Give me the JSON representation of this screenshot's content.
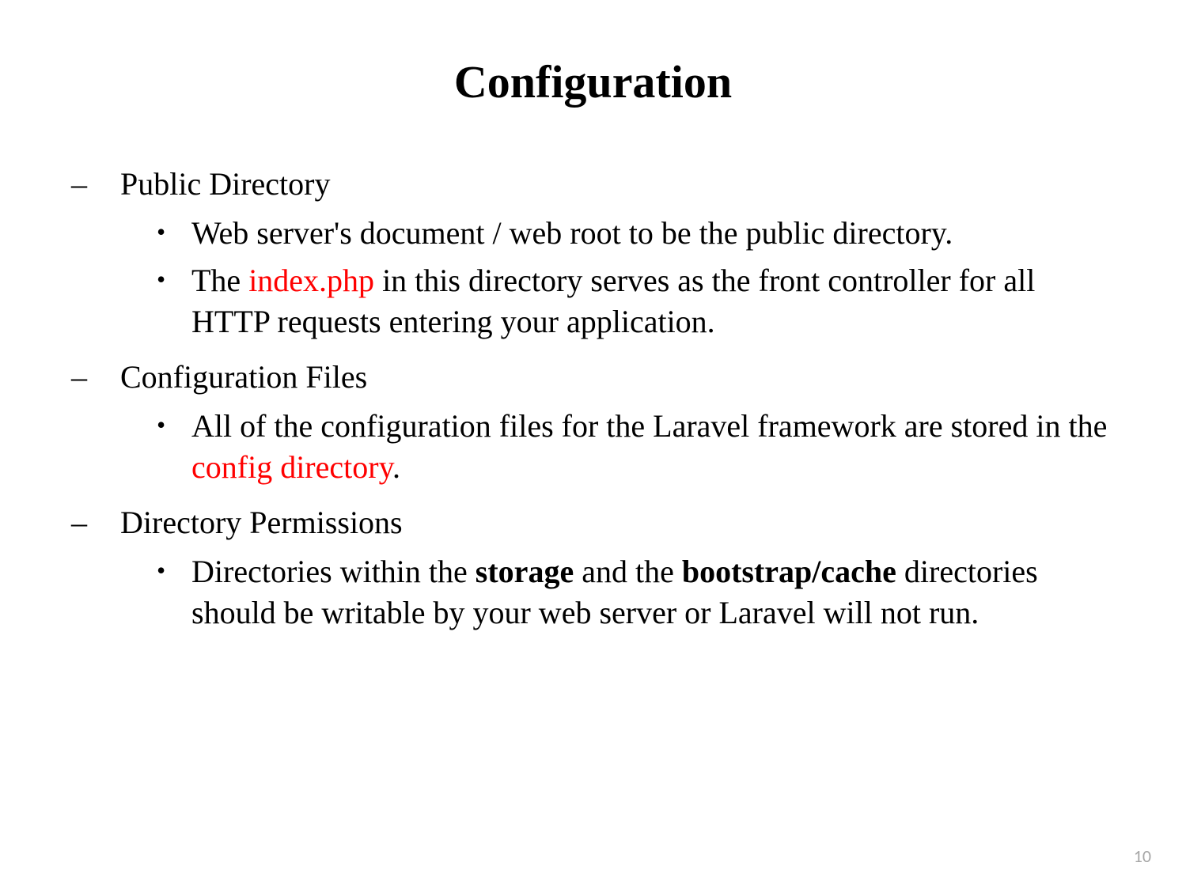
{
  "title": "Configuration",
  "sections": [
    {
      "heading": "Public Directory",
      "bullet0": "Web server's document / web root to be the public directory.",
      "bullet1_pre": "The ",
      "bullet1_red": "index.php",
      "bullet1_post": " in this directory serves as the front controller for all HTTP requests entering your application."
    },
    {
      "heading": "Configuration Files",
      "bullet0_pre": "All of the configuration files for the Laravel framework are stored in the ",
      "bullet0_red": "config directory",
      "bullet0_post": "."
    },
    {
      "heading": "Directory Permissions",
      "bullet0_pre": "Directories within the ",
      "bullet0_b1": "storage",
      "bullet0_mid": " and the ",
      "bullet0_b2": "bootstrap/cache",
      "bullet0_post": " directories should be writable by your web server or Laravel will not run."
    }
  ],
  "page_number": "10"
}
